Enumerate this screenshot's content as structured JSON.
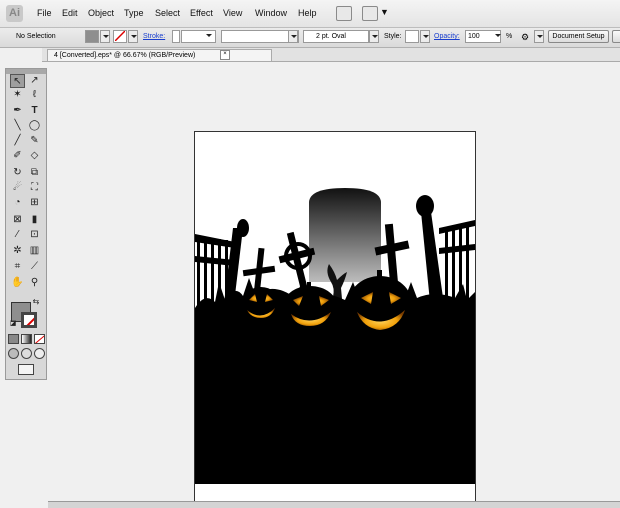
{
  "app": {
    "logo": "Ai"
  },
  "menu": [
    "File",
    "Edit",
    "Object",
    "Type",
    "Select",
    "Effect",
    "View",
    "Window",
    "Help"
  ],
  "control": {
    "selection": "No Selection",
    "stroke_label": "Stroke:",
    "brush": "2 pt. Oval",
    "style_label": "Style:",
    "opacity_label": "Opacity:",
    "opacity_value": "100",
    "opacity_unit": "%",
    "doc_setup": "Document Setup"
  },
  "document_tab": {
    "title": "4 [Converted].eps* @ 66.67% (RGB/Preview)",
    "close": "×"
  },
  "icons": {
    "tools": [
      "selection-icon",
      "direct-selection-icon",
      "magic-wand-icon",
      "lasso-icon",
      "pen-icon",
      "type-icon",
      "line-icon",
      "ellipse-icon",
      "paintbrush-icon",
      "pencil-icon",
      "blob-brush-icon",
      "eraser-icon",
      "rotate-icon",
      "scale-icon",
      "warp-icon",
      "free-transform-icon",
      "shape-builder-icon",
      "perspective-icon",
      "mesh-icon",
      "gradient-icon",
      "eyedropper-icon",
      "blend-icon",
      "symbol-sprayer-icon",
      "column-graph-icon",
      "artboard-icon",
      "slice-icon",
      "hand-icon",
      "zoom-icon"
    ]
  },
  "colors": {
    "fill": "#8e8e8e",
    "pumpkin": "#f2a20c",
    "artwork": "#000000"
  }
}
